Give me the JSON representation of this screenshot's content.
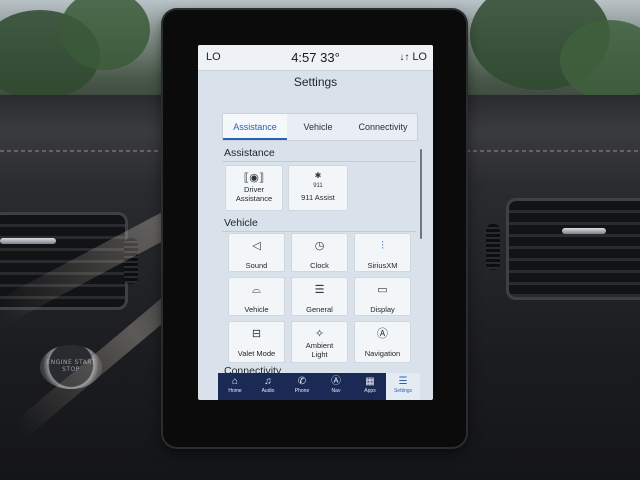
{
  "status": {
    "left_temp": "LO",
    "time_temp": "4:57  33°",
    "right_temp": "LO"
  },
  "title": "Settings",
  "tabs": [
    {
      "label": "Assistance",
      "active": true
    },
    {
      "label": "Vehicle",
      "active": false
    },
    {
      "label": "Connectivity",
      "active": false
    }
  ],
  "sections": {
    "assistance": {
      "title": "Assistance",
      "tiles": [
        {
          "label": "Driver Assistance",
          "icon": "driver-assist-icon"
        },
        {
          "label": "911 Assist",
          "icon": "911-assist-icon",
          "badge": "911"
        }
      ]
    },
    "vehicle": {
      "title": "Vehicle",
      "tiles": [
        {
          "label": "Sound",
          "icon": "speaker-icon"
        },
        {
          "label": "Clock",
          "icon": "clock-icon"
        },
        {
          "label": "SiriusXM",
          "icon": "siriusxm-icon"
        },
        {
          "label": "Vehicle",
          "icon": "car-icon"
        },
        {
          "label": "General",
          "icon": "sliders-icon"
        },
        {
          "label": "Display",
          "icon": "display-icon"
        },
        {
          "label": "Valet Mode",
          "icon": "valet-icon"
        },
        {
          "label": "Ambient Light",
          "icon": "ambient-light-icon"
        },
        {
          "label": "Navigation",
          "icon": "navigation-icon"
        }
      ]
    },
    "connectivity": {
      "title": "Connectivity"
    }
  },
  "navbar": [
    {
      "label": "Home",
      "icon": "home-icon",
      "active": false
    },
    {
      "label": "Audio",
      "icon": "music-icon",
      "active": false
    },
    {
      "label": "Phone",
      "icon": "phone-icon",
      "active": false
    },
    {
      "label": "Nav",
      "icon": "nav-icon",
      "active": false
    },
    {
      "label": "Apps",
      "icon": "apps-icon",
      "active": false
    },
    {
      "label": "Settings",
      "icon": "settings-sliders-icon",
      "active": true
    }
  ],
  "dash": {
    "start_button": "ENGINE START STOP"
  },
  "colors": {
    "accent": "#2a62b8",
    "navbar": "#1a2a55",
    "screen_bg": "#d9e2ea"
  }
}
